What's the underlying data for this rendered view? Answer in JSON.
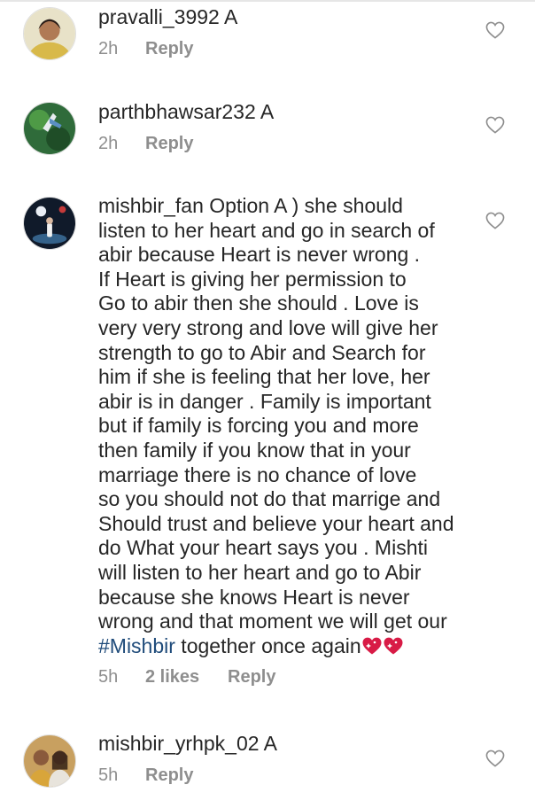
{
  "comments": [
    {
      "username": "pravalli_3992",
      "text": " A",
      "time": "2h",
      "reply_label": "Reply",
      "avatar_icon": "user-avatar-photo"
    },
    {
      "username": "parthbhawsar232",
      "text": " A",
      "time": "2h",
      "reply_label": "Reply",
      "avatar_icon": "user-avatar-photo"
    },
    {
      "username": "mishbir_fan",
      "lines": [
        " Option A ) she should",
        "listen to her heart and go in search of",
        "abir because Heart is never wrong .",
        "If Heart is giving her permission to",
        "Go to abir then she should . Love is",
        "very very strong and love will give her",
        "strength to go to Abir and Search for",
        "him if she is feeling that her love,  her",
        "abir  is in danger . Family is important",
        "but if family is forcing you and more",
        "then family if you know that in your",
        "marriage there is no chance of love",
        "so you should not do that marrige and",
        "Should trust and believe your heart and",
        "do What your heart says you . Mishti",
        "will listen to her heart and go to Abir",
        "because she knows Heart is never",
        "wrong and that moment we will get our"
      ],
      "hashtag": "#Mishbir",
      "last_text": " together once again",
      "emoji_icon": "sparkling-heart-emoji",
      "time": "5h",
      "likes": "2 likes",
      "reply_label": "Reply",
      "avatar_icon": "user-avatar-photo"
    },
    {
      "username": "mishbir_yrhpk_02",
      "text": " A",
      "time": "5h",
      "reply_label": "Reply",
      "avatar_icon": "user-avatar-photo"
    }
  ],
  "like_icon": "heart-outline-icon",
  "colors": {
    "text": "#262626",
    "meta": "#8e8e8e",
    "hashtag": "#1f4b7a",
    "heart_emoji": "#d81b46"
  }
}
